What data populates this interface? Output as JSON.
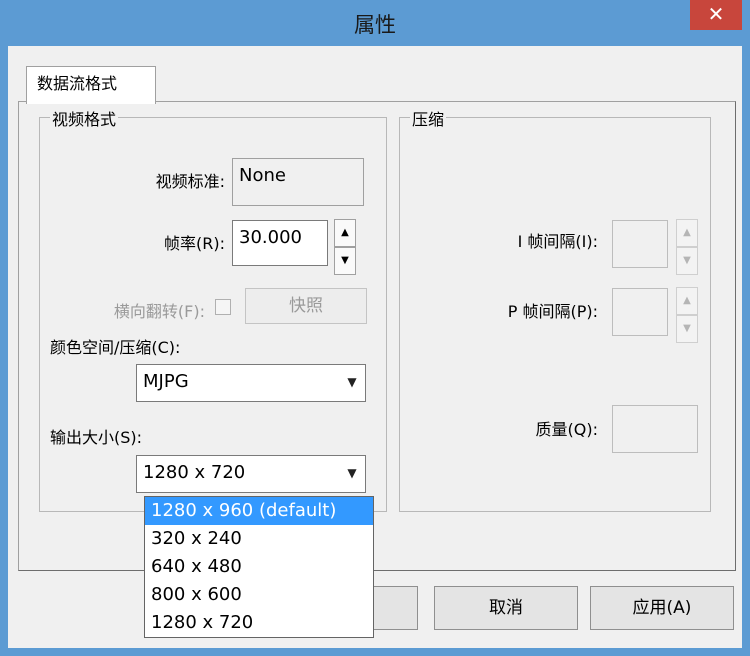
{
  "window": {
    "title": "属性",
    "close_glyph": "✕"
  },
  "tabs": [
    {
      "label": "数据流格式"
    }
  ],
  "video_format": {
    "title": "视频格式",
    "standard_label": "视频标准:",
    "standard_value": "None",
    "framerate_label": "帧率(R):",
    "framerate_value": "30.000",
    "flip_label": "横向翻转(F):",
    "flip_checked": false,
    "snapshot_label": "快照",
    "color_space_label": "颜色空间/压缩(C):",
    "color_space_value": "MJPG",
    "output_size_label": "输出大小(S):",
    "output_size_value": "1280 x 720",
    "output_size_options": [
      "1280 x 960  (default)",
      "320 x 240",
      "640 x 480",
      "800 x 600",
      "1280 x 720"
    ],
    "output_size_highlighted": 0
  },
  "compression": {
    "title": "压缩",
    "i_frame_label": "I 帧间隔(I):",
    "p_frame_label": "P 帧间隔(P):",
    "quality_label": "质量(Q):",
    "quality_level": 0
  },
  "buttons": {
    "cancel": "取消",
    "apply": "应用(A)"
  },
  "icons": {
    "spin_up": "▲",
    "spin_down": "▼",
    "dropdown": "▼"
  }
}
